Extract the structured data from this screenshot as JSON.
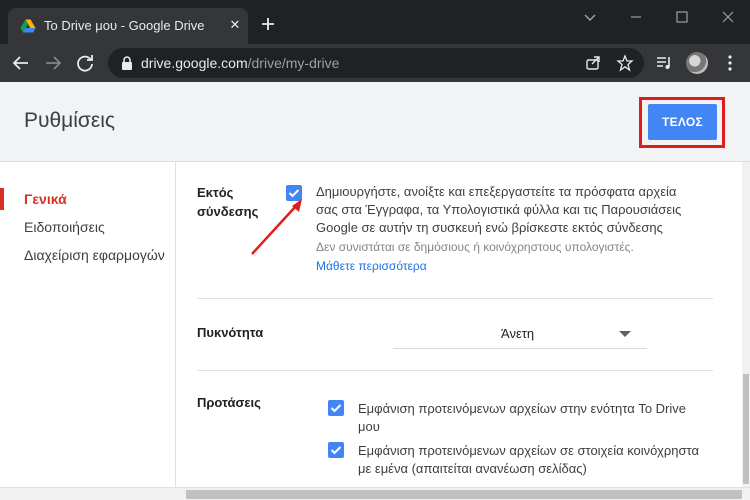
{
  "browser": {
    "tab_title": "To Drive μου - Google Drive",
    "url_host": "drive.google.com",
    "url_path": "/drive/my-drive"
  },
  "dialog": {
    "title": "Ρυθμίσεις",
    "done_label": "ΤΕΛΟΣ"
  },
  "sidebar": {
    "items": [
      {
        "label": "Γενικά",
        "active": true
      },
      {
        "label": "Ειδοποιήσεις",
        "active": false
      },
      {
        "label": "Διαχείριση εφαρμογών",
        "active": false
      }
    ]
  },
  "settings": {
    "offline": {
      "label_line1": "Εκτός",
      "label_line2": "σύνδεσης",
      "checked": true,
      "desc_line1": "Δημιουργήστε, ανοίξτε και επεξεργαστείτε τα πρόσφατα αρχεία",
      "desc_line2": "σας στα Έγγραφα, τα Υπολογιστικά φύλλα και τις Παρουσιάσεις",
      "desc_line3": "Google σε αυτήν τη συσκευή ενώ βρίσκεστε εκτός σύνδεσης",
      "note": "Δεν συνιστάται σε δημόσιους ή κοινόχρηστους υπολογιστές.",
      "learn_more": "Μάθετε περισσότερα"
    },
    "density": {
      "label": "Πυκνότητα",
      "value": "Άνετη"
    },
    "suggestions": {
      "label": "Προτάσεις",
      "option1_line1": "Εμφάνιση προτεινόμενων αρχείων στην ενότητα To Drive",
      "option1_line2": "μου",
      "option1_checked": true,
      "option2_line1": "Εμφάνιση προτεινόμενων αρχείων σε στοιχεία κοινόχρηστα",
      "option2_line2": "με εμένα (απαιτείται ανανέωση σελίδας)",
      "option2_checked": true
    }
  },
  "colors": {
    "accent_blue": "#4285f4",
    "active_red": "#d93025",
    "highlight_red": "#e21b1b"
  }
}
